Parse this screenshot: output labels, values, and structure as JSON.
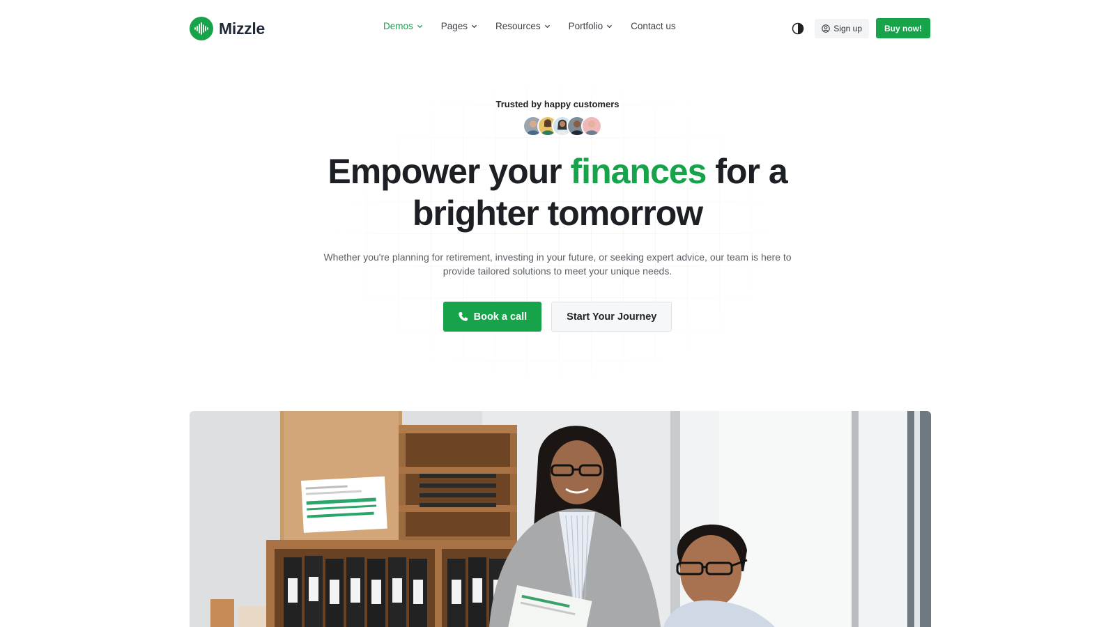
{
  "brand": {
    "name": "Mizzle",
    "accent_color": "#16a34a",
    "logo_icon": "waveform-icon"
  },
  "nav": {
    "items": [
      {
        "label": "Demos",
        "has_dropdown": true,
        "active": true
      },
      {
        "label": "Pages",
        "has_dropdown": true,
        "active": false
      },
      {
        "label": "Resources",
        "has_dropdown": true,
        "active": false
      },
      {
        "label": "Portfolio",
        "has_dropdown": true,
        "active": false
      },
      {
        "label": "Contact us",
        "has_dropdown": false,
        "active": false
      }
    ]
  },
  "header_actions": {
    "theme_toggle_icon": "half-circle-contrast-icon",
    "signup_label": "Sign up",
    "signup_icon": "user-circle-icon",
    "buy_label": "Buy now!"
  },
  "hero": {
    "trusted_label": "Trusted by happy customers",
    "avatar_count": 5,
    "headline_part1": "Empower your ",
    "headline_accent": "finances",
    "headline_part2": " for a",
    "headline_line2": "brighter tomorrow",
    "subtext": "Whether you're planning for retirement, investing in your future, or seeking expert advice, our team is here to provide tailored solutions to meet your unique needs.",
    "primary_cta": {
      "label": "Book a call",
      "icon": "phone-icon"
    },
    "secondary_cta": {
      "label": "Start Your Journey"
    }
  },
  "hero_image": {
    "description_icon": "office-team-photo"
  }
}
